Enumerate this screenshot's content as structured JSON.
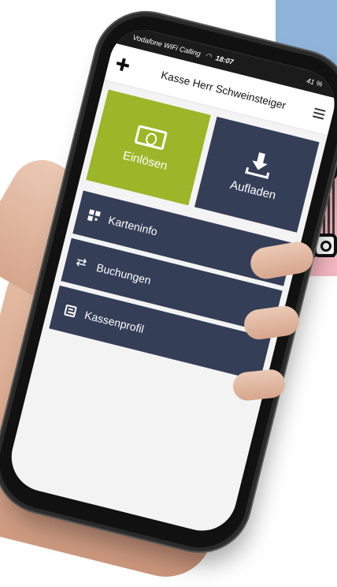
{
  "status_bar": {
    "carrier": "Vodafone WiFi Calling",
    "time": "18:07",
    "battery": "41 %"
  },
  "app_bar": {
    "title": "Kasse Herr Schweinsteiger",
    "logo_icon": "cross-logo-icon",
    "menu_icon": "hamburger-menu-icon"
  },
  "tiles": [
    {
      "label": "Einlösen",
      "icon": "banknote-icon",
      "color": "#9db528"
    },
    {
      "label": "Aufladen",
      "icon": "download-icon",
      "color": "#353e57"
    }
  ],
  "menu": [
    {
      "label": "Karteninfo",
      "icon": "qr-code-icon"
    },
    {
      "label": "Buchungen",
      "icon": "swap-arrows-icon"
    },
    {
      "label": "Kassenprofil",
      "icon": "calculator-icon"
    }
  ],
  "colors": {
    "accent_green": "#9db528",
    "navy": "#353e57",
    "screen_bg": "#f3f3f4"
  }
}
